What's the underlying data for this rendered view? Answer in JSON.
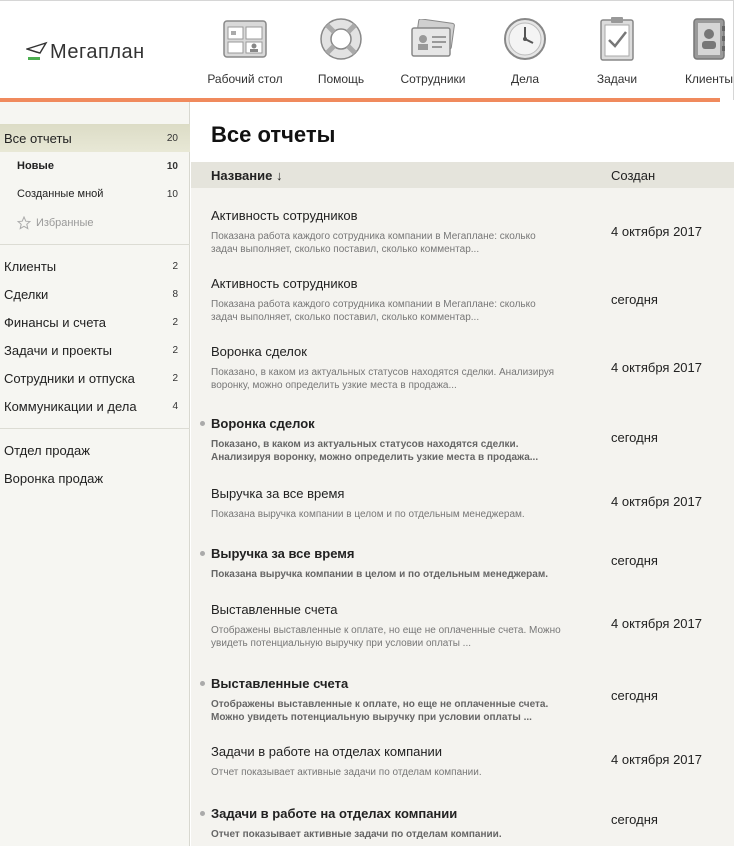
{
  "header": {
    "logo_text": "Мегаплан",
    "nav": [
      {
        "label": "Рабочий стол",
        "icon": "desktop-icon"
      },
      {
        "label": "Помощь",
        "icon": "lifebuoy-icon"
      },
      {
        "label": "Сотрудники",
        "icon": "employees-icon"
      },
      {
        "label": "Дела",
        "icon": "clock-icon"
      },
      {
        "label": "Задачи",
        "icon": "clipboard-icon"
      },
      {
        "label": "Клиенты",
        "icon": "contacts-book-icon"
      }
    ],
    "accent_color": "#f08a5d"
  },
  "sidebar": {
    "all_reports": {
      "label": "Все отчеты",
      "count": "20"
    },
    "new": {
      "label": "Новые",
      "count": "10"
    },
    "mine": {
      "label": "Созданные мной",
      "count": "10"
    },
    "favorites": {
      "label": "Избранные"
    },
    "categories": [
      {
        "label": "Клиенты",
        "count": "2"
      },
      {
        "label": "Сделки",
        "count": "8"
      },
      {
        "label": "Финансы и счета",
        "count": "2"
      },
      {
        "label": "Задачи и проекты",
        "count": "2"
      },
      {
        "label": "Сотрудники и отпуска",
        "count": "2"
      },
      {
        "label": "Коммуникации и дела",
        "count": "4"
      }
    ],
    "extra": [
      {
        "label": "Отдел продаж"
      },
      {
        "label": "Воронка продаж"
      }
    ]
  },
  "main": {
    "title": "Все отчеты",
    "columns": {
      "name": "Название ↓",
      "created": "Создан"
    },
    "rows": [
      {
        "title": "Активность сотрудников",
        "desc1": "Показана работа каждого сотрудника компании в Мегаплане: сколько",
        "desc2": "задач выполняет, сколько поставил, сколько комментар...",
        "date": "4 октября 2017",
        "bold": false
      },
      {
        "title": "Активность сотрудников",
        "desc1": "Показана работа каждого сотрудника компании в Мегаплане: сколько",
        "desc2": "задач выполняет, сколько поставил, сколько комментар...",
        "date": "сегодня",
        "bold": false
      },
      {
        "title": "Воронка сделок",
        "desc1": "Показано, в каком из актуальных статусов находятся сделки. Анализируя",
        "desc2": "воронку, можно определить узкие места в продажа...",
        "date": "4 октября 2017",
        "bold": false
      },
      {
        "title": "Воронка сделок",
        "desc1": "Показано, в каком из актуальных статусов находятся сделки.",
        "desc2": "Анализируя воронку, можно определить узкие места в продажа...",
        "date": "сегодня",
        "bold": true
      },
      {
        "title": "Выручка за все время",
        "desc1": "Показана выручка компании в целом и по отдельным менеджерам.",
        "desc2": "",
        "date": "4 октября 2017",
        "bold": false
      },
      {
        "title": "Выручка за все время",
        "desc1": "Показана выручка компании в целом и по отдельным менеджерам.",
        "desc2": "",
        "date": "сегодня",
        "bold": true
      },
      {
        "title": "Выставленные счета",
        "desc1": "Отображены выставленные к оплате, но еще не оплаченные счета. Можно",
        "desc2": "увидеть потенциальную выручку при условии оплаты ...",
        "date": "4 октября 2017",
        "bold": false
      },
      {
        "title": "Выставленные счета",
        "desc1": "Отображены выставленные к оплате, но еще не оплаченные счета.",
        "desc2": "Можно увидеть потенциальную выручку при условии оплаты ...",
        "date": "сегодня",
        "bold": true
      },
      {
        "title": "Задачи в работе на отделах компании",
        "desc1": "Отчет показывает активные задачи по отделам компании.",
        "desc2": "",
        "date": "4 октября 2017",
        "bold": false
      },
      {
        "title": "Задачи в работе на отделах компании",
        "desc1": "Отчет показывает активные задачи по отделам компании.",
        "desc2": "",
        "date": "сегодня",
        "bold": true
      }
    ]
  }
}
